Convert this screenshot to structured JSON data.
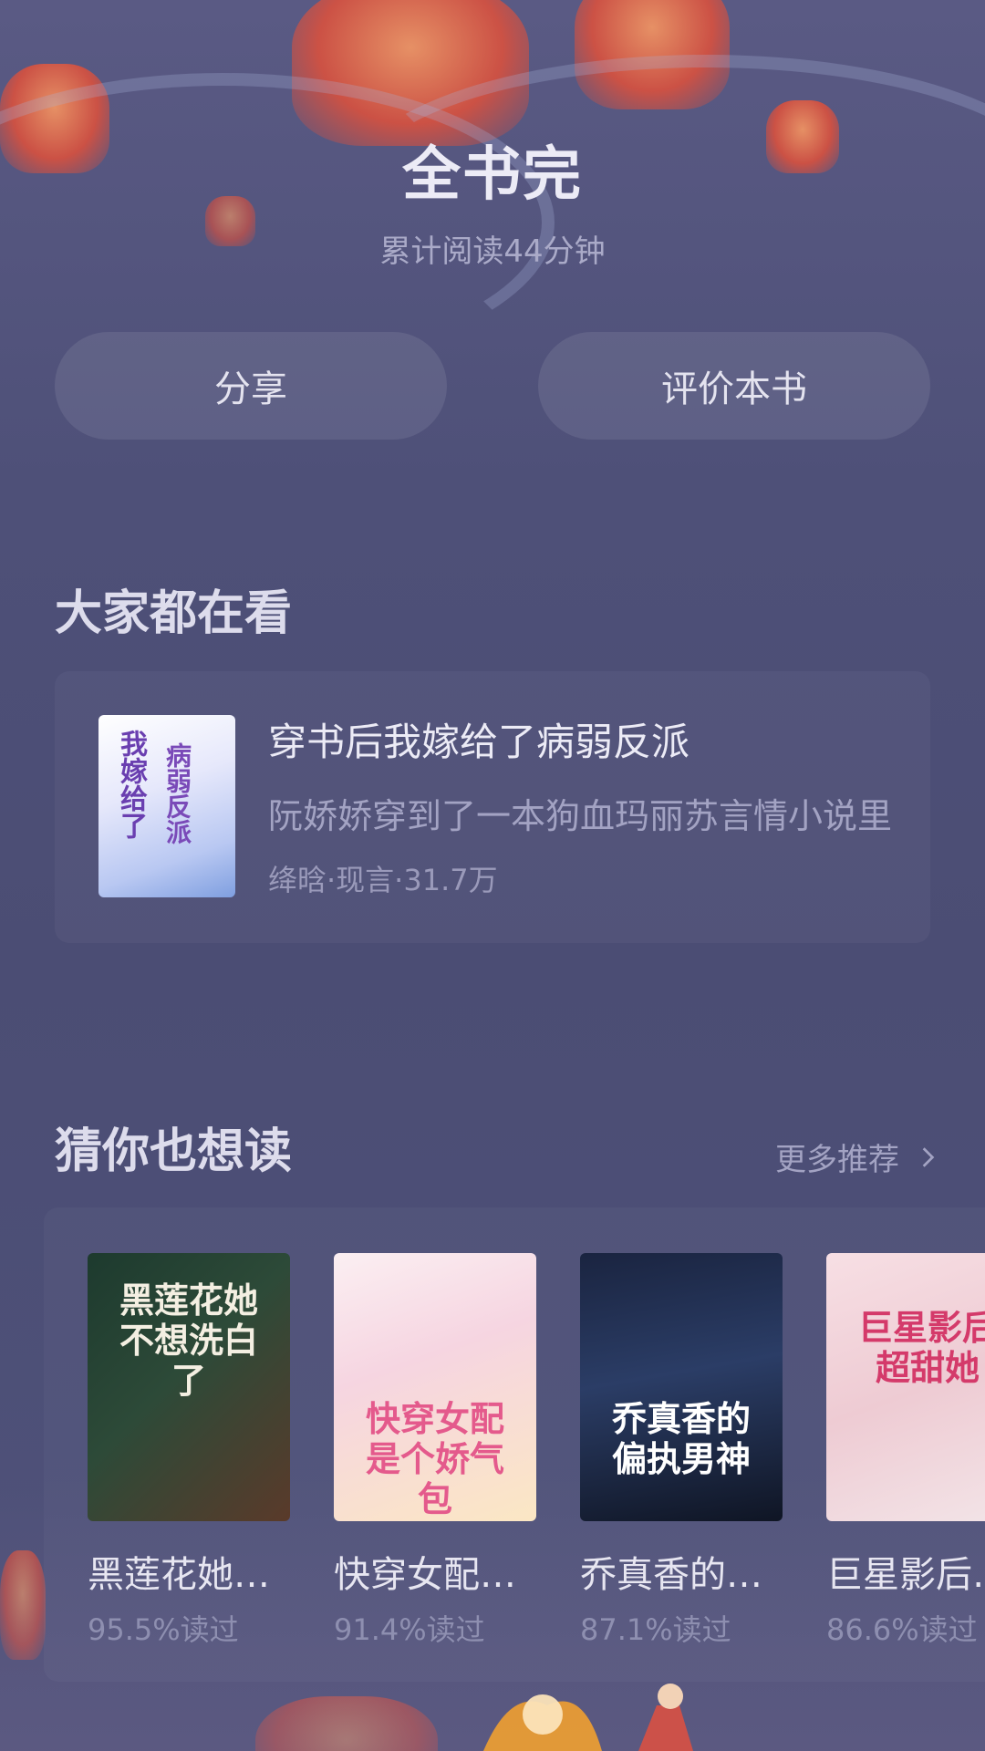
{
  "header": {
    "title": "全书完",
    "subtitle": "累计阅读44分钟"
  },
  "actions": {
    "share_label": "分享",
    "rate_label": "评价本书"
  },
  "section_popular": {
    "title": "大家都在看",
    "book": {
      "name": "穿书后我嫁给了病弱反派",
      "description": "阮娇娇穿到了一本狗血玛丽苏言情小说里",
      "meta": "绛晗·现言·31.7万",
      "cover_text_a": "我嫁给了",
      "cover_text_b": "病弱反派"
    }
  },
  "section_guess": {
    "title": "猜你也想读",
    "more_label": "更多推荐",
    "books": [
      {
        "name": "黑莲花她…",
        "percent": "95.5%读过",
        "cover_text": "黑莲花她不想洗白了"
      },
      {
        "name": "快穿女配…",
        "percent": "91.4%读过",
        "cover_text": "快穿女配是个娇气包"
      },
      {
        "name": "乔真香的…",
        "percent": "87.1%读过",
        "cover_text": "乔真香的偏执男神"
      },
      {
        "name": "巨星影后…",
        "percent": "86.6%读过",
        "cover_text": "巨星影后超甜她"
      }
    ]
  },
  "colors": {
    "background": "#4c4e74",
    "text_primary": "#ecebf6",
    "text_secondary": "#a3a3c3",
    "lantern": "#e0503a"
  }
}
